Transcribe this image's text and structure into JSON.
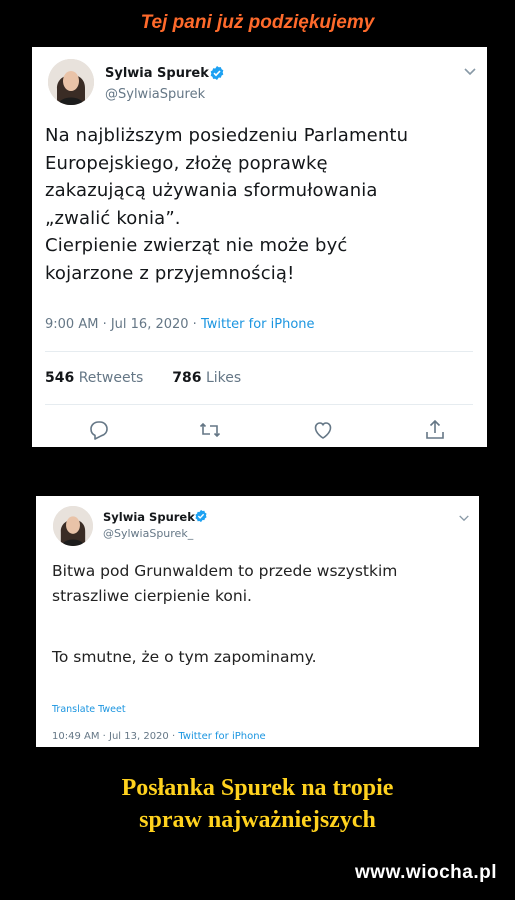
{
  "header_caption": "Tej pani już podziękujemy",
  "tweet1": {
    "author_name": "Sylwia Spurek",
    "handle": "@SylwiaSpurek",
    "text": "Na najbliższym posiedzeniu Parlamentu\nEuropejskiego, złożę poprawkę\nzakazującą używania sformułowania\n„zwalić konia”.\nCierpienie zwierząt nie może być\nkojarzone z przyjemnością!",
    "time_date": "9:00 AM · Jul 16, 2020 · ",
    "source": "Twitter for iPhone",
    "retweets_count": "546",
    "retweets_label": "Retweets",
    "likes_count": "786",
    "likes_label": "Likes",
    "icons": [
      "reply-icon",
      "retweet-icon",
      "like-icon",
      "share-icon",
      "verified-badge-icon",
      "chevron-down-icon"
    ],
    "accent_color": "#1da1f2"
  },
  "tweet2": {
    "author_name": "Sylwia Spurek",
    "handle": "@SylwiaSpurek_",
    "text_p1": "Bitwa pod Grunwaldem to przede wszystkim\nstraszliwe cierpienie koni.",
    "text_p2": "To smutne, że o tym zapominamy.",
    "translate_label": "Translate Tweet",
    "time_date": "10:49 AM · Jul 13, 2020 · ",
    "source": "Twitter for iPhone"
  },
  "footer_caption": "Posłanka Spurek na tropie\nspraw najważniejszych",
  "watermark": "www.wiocha.pl"
}
